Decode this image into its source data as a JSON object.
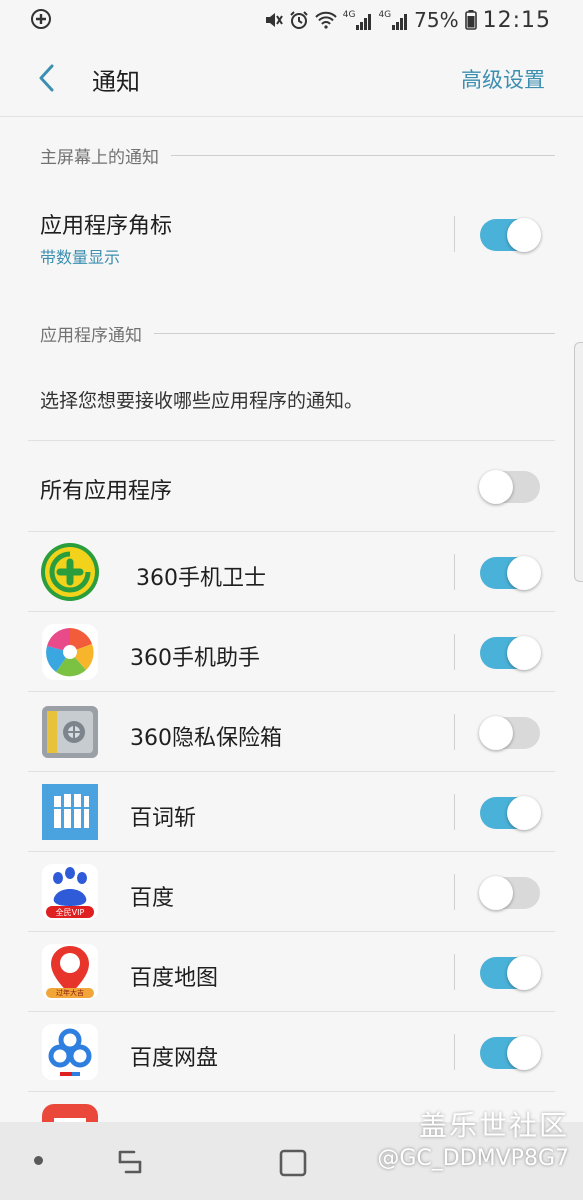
{
  "status_bar": {
    "battery": "75%",
    "time": "12:15",
    "network_labels": [
      "4G",
      "4G"
    ]
  },
  "app_bar": {
    "title": "通知",
    "advanced_label": "高级设置"
  },
  "home_section": {
    "header": "主屏幕上的通知",
    "badge_row": {
      "title": "应用程序角标",
      "subtitle": "带数量显示",
      "enabled": true
    }
  },
  "app_section": {
    "header": "应用程序通知",
    "description": "选择您想要接收哪些应用程序的通知。",
    "all_apps": {
      "label": "所有应用程序",
      "enabled": false
    },
    "apps": [
      {
        "name": "360手机卫士",
        "icon": "360-security-icon",
        "enabled": true
      },
      {
        "name": "360手机助手",
        "icon": "360-assistant-icon",
        "enabled": true
      },
      {
        "name": "360隐私保险箱",
        "icon": "360-safe-box-icon",
        "enabled": false
      },
      {
        "name": "百词斩",
        "icon": "baicizhan-icon",
        "enabled": true
      },
      {
        "name": "百度",
        "icon": "baidu-icon",
        "enabled": false,
        "icon_text": "全民VIP"
      },
      {
        "name": "百度地图",
        "icon": "baidu-map-icon",
        "enabled": true,
        "icon_text": "过年大吉"
      },
      {
        "name": "百度网盘",
        "icon": "baidu-netdisk-icon",
        "enabled": true
      }
    ]
  },
  "watermark": {
    "site": "盖乐世社区",
    "user": "@GC_DDMVP8G7"
  },
  "colors": {
    "accent": "#4ab1d8",
    "link": "#3d8fb0",
    "toggle_off": "#d9d9d9",
    "background": "#f6f6f6"
  }
}
